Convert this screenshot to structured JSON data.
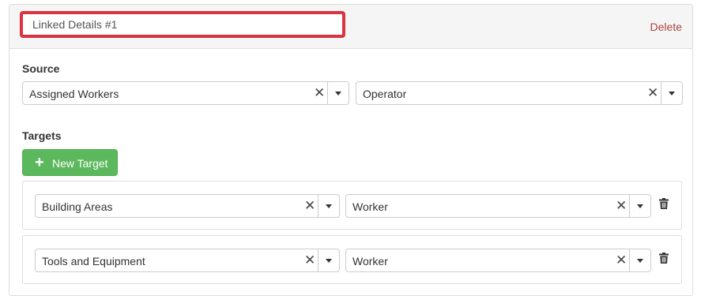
{
  "linked_details": {
    "name_value": "Linked Details #1",
    "delete_label": "Delete"
  },
  "source": {
    "label": "Source",
    "left_select": {
      "value": "Assigned Workers",
      "clear_glyph": "✕"
    },
    "right_select": {
      "value": "Operator",
      "clear_glyph": "✕"
    }
  },
  "targets": {
    "label": "Targets",
    "new_button": {
      "icon": "plus-icon",
      "label": "New Target"
    },
    "rows": [
      {
        "left_select": {
          "value": "Building Areas",
          "clear_glyph": "✕"
        },
        "right_select": {
          "value": "Worker",
          "clear_glyph": "✕"
        },
        "remove_icon": "trash-icon"
      },
      {
        "left_select": {
          "value": "Tools and Equipment",
          "clear_glyph": "✕"
        },
        "right_select": {
          "value": "Worker",
          "clear_glyph": "✕"
        },
        "remove_icon": "trash-icon"
      }
    ]
  },
  "colors": {
    "highlight_border": "#d9343f",
    "delete_text": "#a94442",
    "success_button": "#5cb85c"
  }
}
